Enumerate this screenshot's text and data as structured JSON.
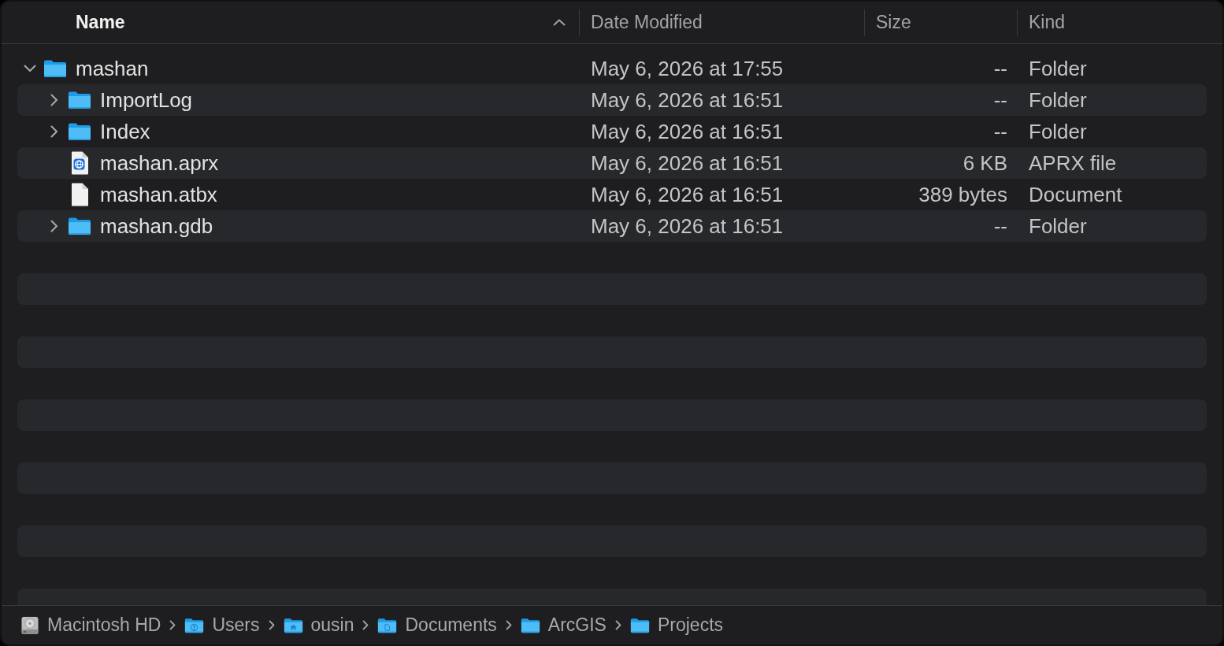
{
  "columns": [
    {
      "label": "Name",
      "sorted": true
    },
    {
      "label": "Date Modified",
      "sorted": false
    },
    {
      "label": "Size",
      "sorted": false
    },
    {
      "label": "Kind",
      "sorted": false
    }
  ],
  "rows": [
    {
      "kind": "folder",
      "name": "mashan",
      "date_modified": "May 6, 2026 at 17:55",
      "size": "--",
      "kind_text": "Folder",
      "expanded": true,
      "children": [
        {
          "kind": "folder",
          "name": "ImportLog",
          "date_modified": "May 6, 2026 at 16:51",
          "size": "--",
          "kind_text": "Folder",
          "expanded": false
        },
        {
          "kind": "folder",
          "name": "Index",
          "date_modified": "May 6, 2026 at 16:51",
          "size": "--",
          "kind_text": "Folder",
          "expanded": false
        },
        {
          "kind": "aprx",
          "name": "mashan.aprx",
          "date_modified": "May 6, 2026 at 16:51",
          "size": "6 KB",
          "kind_text": "APRX file"
        },
        {
          "kind": "file",
          "name": "mashan.atbx",
          "date_modified": "May 6, 2026 at 16:51",
          "size": "389 bytes",
          "kind_text": "Document"
        },
        {
          "kind": "folder",
          "name": "mashan.gdb",
          "date_modified": "May 6, 2026 at 16:51",
          "size": "--",
          "kind_text": "Folder",
          "expanded": false
        }
      ]
    }
  ],
  "path_bar": [
    {
      "kind": "disk",
      "label": "Macintosh HD"
    },
    {
      "kind": "users",
      "label": "Users"
    },
    {
      "kind": "home",
      "label": "ousin"
    },
    {
      "kind": "documents",
      "label": "Documents"
    },
    {
      "kind": "folder",
      "label": "ArcGIS"
    },
    {
      "kind": "folder",
      "label": "Projects"
    }
  ]
}
